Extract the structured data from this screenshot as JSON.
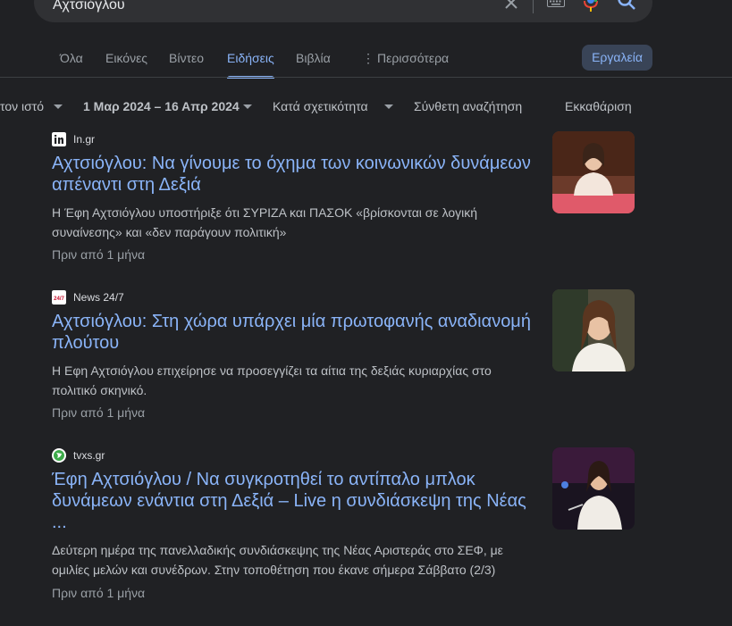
{
  "search": {
    "query": "Αχτσιόγλου"
  },
  "tabs": [
    {
      "label": "Όλα"
    },
    {
      "label": "Εικόνες"
    },
    {
      "label": "Βίντεο"
    },
    {
      "label": "Ειδήσεις"
    },
    {
      "label": "Βιβλία"
    },
    {
      "label": "Περισσότερα"
    }
  ],
  "tools_label": "Εργαλεία",
  "filters": {
    "site": "τον ιστό",
    "date_range": "1 Μαρ 2024 – 16 Απρ 2024",
    "sort": "Κατά σχετικότητα",
    "advanced": "Σύνθετη αναζήτηση",
    "clear": "Εκκαθάριση"
  },
  "results": [
    {
      "source": "In.gr",
      "title": "Αχτσιόγλου: Να γίνουμε το όχημα των κοινωνικών δυνάμεων απέναντι στη Δεξιά",
      "snippet": "Η Έφη Αχτσιόγλου υποστήριξε ότι ΣΥΡΙΖΑ και ΠΑΣΟΚ «βρίσκονται σε λογική συναίνεσης» και «δεν παράγουν πολιτική»",
      "time": "Πριν από 1 μήνα"
    },
    {
      "source": "News 24/7",
      "title": "Αχτσιόγλου: Στη χώρα υπάρχει μία πρωτοφανής αναδιανομή πλούτου",
      "snippet": "Η Εφη Αχτσιόγλου επιχείρησε να προσεγγίζει τα αίτια της δεξιάς κυριαρχίας στο πολιτικό σκηνικό.",
      "time": "Πριν από 1 μήνα"
    },
    {
      "source": "tvxs.gr",
      "title": "Έφη Αχτσιόγλου / Να συγκροτηθεί το αντίπαλο μπλοκ δυνάμεων ενάντια στη Δεξιά – Live η συνδιάσκεψη της Νέας ...",
      "snippet": "Δεύτερη ημέρα της πανελλαδικής συνδιάσκεψης της Νέας Αριστεράς στο ΣΕΦ, με ομιλίες μελών και συνέδρων. Στην τοποθέτηση που έκανε σήμερα Σάββατο (2/3)",
      "time": "Πριν από 1 μήνα"
    }
  ],
  "favicon_text": {
    "news247": "24/7"
  },
  "colors": {
    "background": "#202124",
    "link": "#8ab4f8",
    "text": "#bdc1c6",
    "muted": "#9aa0a6",
    "tools_bg": "#394457"
  }
}
